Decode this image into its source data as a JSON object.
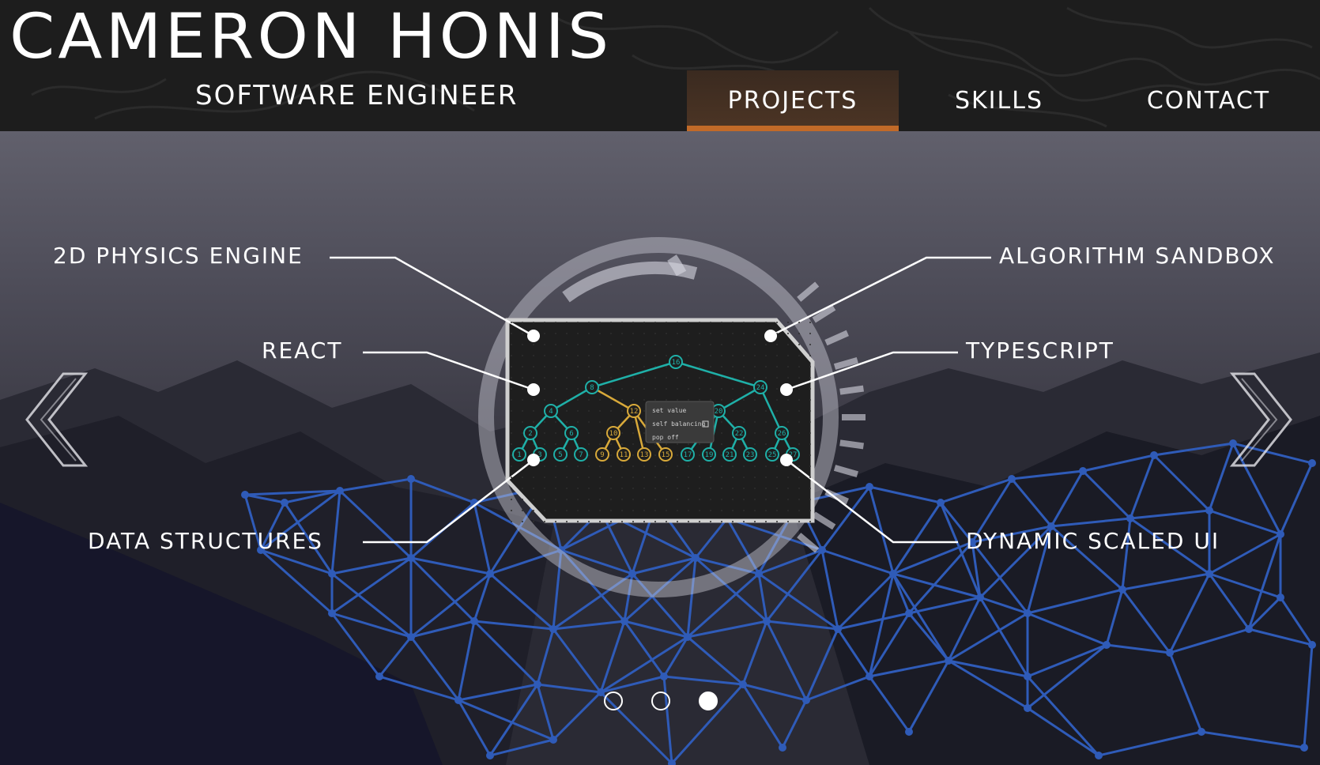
{
  "header": {
    "title": "CAMERON HONIS",
    "subtitle": "SOFTWARE ENGINEER"
  },
  "nav": {
    "tabs": [
      {
        "label": "PROJECTS",
        "active": true
      },
      {
        "label": "SKILLS",
        "active": false
      },
      {
        "label": "CONTACT",
        "active": false
      }
    ]
  },
  "carousel": {
    "callouts": {
      "left_top": "2D PHYSICS ENGINE",
      "left_middle": "REACT",
      "left_bottom": "DATA STRUCTURES",
      "right_top": "ALGORITHM SANDBOX",
      "right_middle": "TYPESCRIPT",
      "right_bottom": "DYNAMIC SCALED UI"
    },
    "slide_count": 3,
    "active_slide": 3,
    "preview": {
      "menu": [
        "set value",
        "self balancing",
        "pop off"
      ],
      "tree_nodes": [
        "16",
        "8",
        "24",
        "4",
        "12",
        "20",
        "2",
        "6",
        "10",
        "22",
        "26",
        "1",
        "3",
        "5",
        "7",
        "9",
        "11",
        "13",
        "15",
        "17",
        "19",
        "21",
        "23",
        "25",
        "27"
      ]
    },
    "icons": {
      "prev": "chevron-left-icon",
      "next": "chevron-right-icon"
    }
  },
  "colors": {
    "accent": "#c26a28",
    "mesh": "#2f5bb8",
    "tree_teal": "#1fb0a8",
    "tree_gold": "#d8a93a",
    "header_bg": "#1d1d1d"
  }
}
